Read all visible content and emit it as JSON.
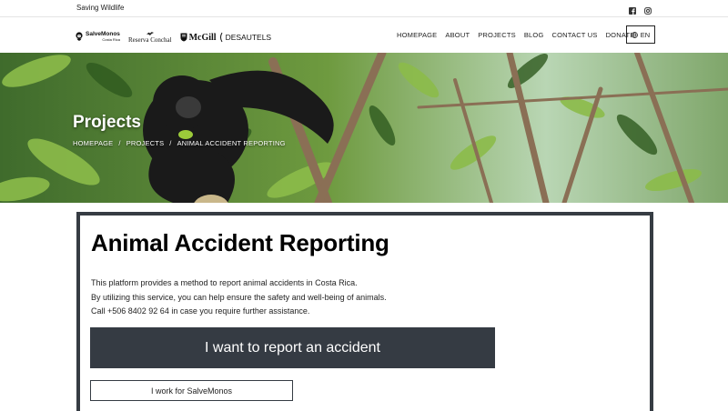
{
  "topbar": {
    "tagline": "Saving Wildlife",
    "social_icons": [
      "facebook-icon",
      "instagram-icon"
    ]
  },
  "logos": {
    "salvemonos": {
      "name": "SalveMonos",
      "sub": "Costa Rica"
    },
    "reserva": "Reserva Conchal",
    "mcgill": "McGill",
    "desautels": "DESAUTELS"
  },
  "nav": {
    "items": [
      "HOMEPAGE",
      "ABOUT",
      "PROJECTS",
      "BLOG",
      "CONTACT US",
      "DONATE"
    ],
    "language": "EN"
  },
  "hero": {
    "title": "Projects",
    "breadcrumb": [
      "HOMEPAGE",
      "/",
      "PROJECTS",
      "/",
      "ANIMAL ACCIDENT REPORTING"
    ]
  },
  "main": {
    "heading": "Animal Accident Reporting",
    "intro": [
      "This platform provides a method to report animal accidents in Costa Rica.",
      "By utilizing this service, you can help ensure the safety and well-being of animals.",
      "Call +506 8402 92 64 in case you require further assistance."
    ],
    "report_button": "I want to report an accident",
    "staff_button": "I work for SalveMonos"
  },
  "colors": {
    "dark": "#353b43",
    "foliage": "#5a7a3a"
  }
}
